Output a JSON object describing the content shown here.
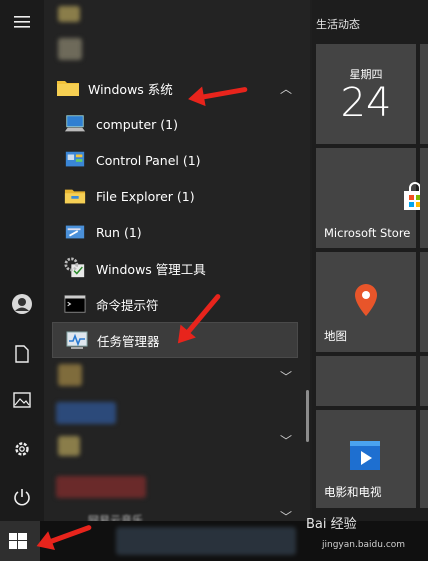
{
  "tiles": {
    "header": "生活动态",
    "calendar": {
      "weekday": "星期四",
      "day": "24"
    },
    "store_label": "Microsoft Store",
    "maps_label": "地图",
    "movies_label": "电影和电视"
  },
  "folder": {
    "label": "Windows 系统",
    "expanded": true
  },
  "items": [
    {
      "label": "computer (1)",
      "icon": "computer-icon"
    },
    {
      "label": "Control Panel (1)",
      "icon": "control-panel-icon"
    },
    {
      "label": "File Explorer (1)",
      "icon": "file-explorer-icon"
    },
    {
      "label": "Run (1)",
      "icon": "run-icon"
    },
    {
      "label": "Windows 管理工具",
      "icon": "admin-tools-icon"
    },
    {
      "label": "命令提示符",
      "icon": "command-prompt-icon"
    },
    {
      "label": "任务管理器",
      "icon": "task-manager-icon"
    }
  ],
  "blurred_bottom_label": "网易云音乐",
  "watermark": {
    "text": "Bai 经验",
    "url_text": "jingyan.baidu.com"
  },
  "colors": {
    "accent_arrow": "#e8241c",
    "folder": "#f2c23a",
    "tile": "#444444"
  }
}
